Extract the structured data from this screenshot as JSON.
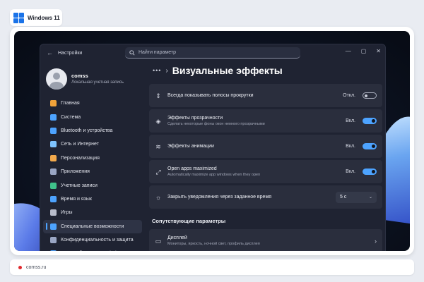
{
  "badge": {
    "label": "Windows 11",
    "logo_color": "#1a73e8"
  },
  "window": {
    "title": "Настройки",
    "search_placeholder": "Найти параметр",
    "controls": {
      "minimize": "—",
      "maximize": "▢",
      "close": "✕"
    }
  },
  "profile": {
    "name": "comss",
    "subtitle": "Локальная учетная запись"
  },
  "sidebar": {
    "items": [
      {
        "label": "Главная",
        "icon": "home-icon",
        "color": "#f0a23a"
      },
      {
        "label": "Система",
        "icon": "system-icon",
        "color": "#4da3ff"
      },
      {
        "label": "Bluetooth и устройства",
        "icon": "bluetooth-icon",
        "color": "#4da3ff"
      },
      {
        "label": "Сеть и Интернет",
        "icon": "network-icon",
        "color": "#7ec3ff"
      },
      {
        "label": "Персонализация",
        "icon": "brush-icon",
        "color": "#f2a94c"
      },
      {
        "label": "Приложения",
        "icon": "apps-icon",
        "color": "#9aa6c4"
      },
      {
        "label": "Учетные записи",
        "icon": "accounts-icon",
        "color": "#3fc28b"
      },
      {
        "label": "Время и язык",
        "icon": "globe-icon",
        "color": "#4da3ff"
      },
      {
        "label": "Игры",
        "icon": "gamepad-icon",
        "color": "#b8bccb"
      },
      {
        "label": "Специальные возможности",
        "icon": "accessibility-icon",
        "color": "#4da3ff"
      },
      {
        "label": "Конфиденциальность и защита",
        "icon": "shield-icon",
        "color": "#9aa6c4"
      },
      {
        "label": "Центр обновления Windows",
        "icon": "update-icon",
        "color": "#4da3ff"
      }
    ],
    "active_index": 9
  },
  "content": {
    "breadcrumb_more": "•••",
    "title": "Визуальные эффекты",
    "rows": [
      {
        "title": "Всегда показывать полосы прокрутки",
        "subtitle": "",
        "state": "Откл.",
        "on": false
      },
      {
        "title": "Эффекты прозрачности",
        "subtitle": "Сделать некоторые фоны окон немного прозрачными",
        "state": "Вкл.",
        "on": true
      },
      {
        "title": "Эффекты анимации",
        "subtitle": "",
        "state": "Вкл.",
        "on": true
      },
      {
        "title": "Open apps maximized",
        "subtitle": "Automatically maximize app windows when they open",
        "state": "Вкл.",
        "on": true
      }
    ],
    "notify_row": {
      "title": "Закрыть уведомления через заданное время",
      "value": "5 с"
    },
    "related_heading": "Сопутствующие параметры",
    "related": [
      {
        "title": "Дисплей",
        "subtitle": "Мониторы, яркость, ночной свет, профиль дисплея"
      }
    ]
  },
  "footer": {
    "text": "comss.ru",
    "dot_color": "#e0282d"
  }
}
